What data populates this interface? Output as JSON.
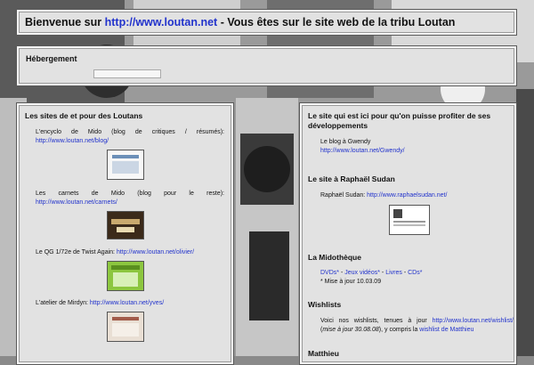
{
  "header": {
    "prefix": "Bienvenue sur ",
    "link": "http://www.loutan.net",
    "suffix": " - Vous êtes sur le site web de la tribu Loutan"
  },
  "hosting": {
    "title": "Hébergement"
  },
  "left": {
    "title": "Les sites de et pour des Loutans",
    "items": [
      {
        "line1": "L'encyclo de Mido (blog de critiques / résumés):",
        "link": "http://www.loutan.net/blog/"
      },
      {
        "line1": "Les carnets de Mido (blog pour le reste):",
        "link": "http://www.loutan.net/carnets/"
      },
      {
        "text": "Le QG 1/72e de Twist Again: ",
        "link": "http://www.loutan.net/olivier/"
      },
      {
        "text": "L'atelier de Mirdyn: ",
        "link": "http://www.loutan.net/yves/"
      }
    ]
  },
  "right": {
    "dev": {
      "title_line1": "Le site qui est ici pour qu'on puisse profiter de ses",
      "title_line2": "développements",
      "line1": "Le blog à Gwendy",
      "link": "http://www.loutan.net/Gwendy/"
    },
    "raphael": {
      "title": "Le site à Raphaël Sudan",
      "text": "Raphaël Sudan: ",
      "link": "http://www.raphaelsudan.net/"
    },
    "midotheque": {
      "title": "La Midothèque",
      "links": [
        "DVDs*",
        "Jeux vidéos*",
        "Livres",
        "CDs*"
      ],
      "sep": " - ",
      "note": "* Mise à jour 10.03.09"
    },
    "wishlists": {
      "title": "Wishlists",
      "line1_text": "Voici nos wishlists, tenues à jour ",
      "line1_link": "http://www.loutan.net/wishlist/",
      "line2_open": "(",
      "line2_italic": "mise à jour 30.08.08",
      "line2_mid": "), y compris la ",
      "line2_link": "wishlist de Matthieu"
    },
    "matthieu": {
      "title": "Matthieu"
    }
  }
}
